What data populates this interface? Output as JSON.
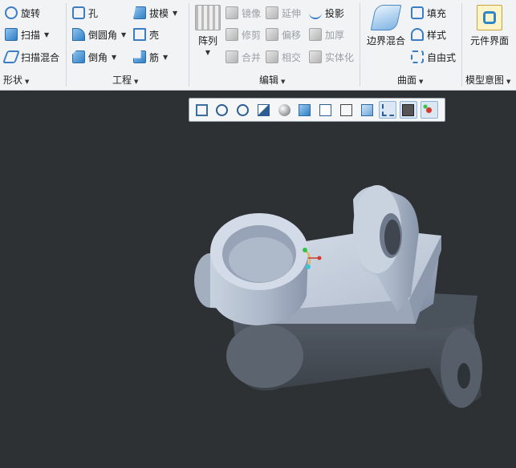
{
  "ribbon": {
    "shape": {
      "items": [
        {
          "label": "旋转",
          "icon": "revolve-icon"
        },
        {
          "label": "扫描",
          "icon": "sweep-icon",
          "dropdown": true
        },
        {
          "label": "扫描混合",
          "icon": "swept-blend-icon"
        }
      ],
      "group_label": "形状"
    },
    "engineering": {
      "items": [
        {
          "label": "孔",
          "icon": "hole-icon"
        },
        {
          "label": "倒圆角",
          "icon": "round-icon",
          "dropdown": true
        },
        {
          "label": "倒角",
          "icon": "chamfer-icon",
          "dropdown": true
        },
        {
          "label": "拔模",
          "icon": "draft-icon",
          "dropdown": true
        },
        {
          "label": "壳",
          "icon": "shell-icon"
        },
        {
          "label": "筋",
          "icon": "rib-icon",
          "dropdown": true
        }
      ],
      "group_label": "工程"
    },
    "edit": {
      "pattern_label": "阵列",
      "items": [
        {
          "label": "镜像",
          "icon": "mirror-icon",
          "enabled": false
        },
        {
          "label": "延伸",
          "icon": "extend-icon",
          "enabled": false
        },
        {
          "label": "投影",
          "icon": "project-icon",
          "enabled": true
        },
        {
          "label": "修剪",
          "icon": "trim-icon",
          "enabled": false
        },
        {
          "label": "偏移",
          "icon": "offset-icon",
          "enabled": false
        },
        {
          "label": "加厚",
          "icon": "thicken-icon",
          "enabled": false
        },
        {
          "label": "合并",
          "icon": "merge-icon",
          "enabled": false
        },
        {
          "label": "相交",
          "icon": "intersect-icon",
          "enabled": false
        },
        {
          "label": "实体化",
          "icon": "solidify-icon",
          "enabled": false
        }
      ],
      "group_label": "编辑"
    },
    "surface": {
      "boundary_blend_label": "边界混合",
      "items": [
        {
          "label": "填充",
          "icon": "fill-icon"
        },
        {
          "label": "样式",
          "icon": "style-icon"
        },
        {
          "label": "自由式",
          "icon": "freestyle-icon"
        }
      ],
      "group_label": "曲面"
    },
    "model_intent": {
      "component_interface_label": "元件界面",
      "group_label": "模型意图"
    }
  },
  "view_toolbar": {
    "buttons": [
      {
        "icon": "refit-icon"
      },
      {
        "icon": "zoom-in-icon"
      },
      {
        "icon": "zoom-out-icon"
      },
      {
        "icon": "repaint-icon"
      },
      {
        "icon": "perspective-icon"
      },
      {
        "icon": "display-style-icon"
      },
      {
        "icon": "saved-orientations-icon"
      },
      {
        "icon": "view-manager-icon"
      },
      {
        "icon": "section-icon"
      },
      {
        "icon": "datum-display-icon",
        "active": true
      },
      {
        "icon": "annotation-display-icon",
        "active": true
      },
      {
        "icon": "spin-center-icon",
        "active": true
      }
    ]
  },
  "colors": {
    "viewport_bg": "#2d3134",
    "part_fill": "#b9c4d4",
    "ribbon_bg": "#f1f3f5"
  }
}
